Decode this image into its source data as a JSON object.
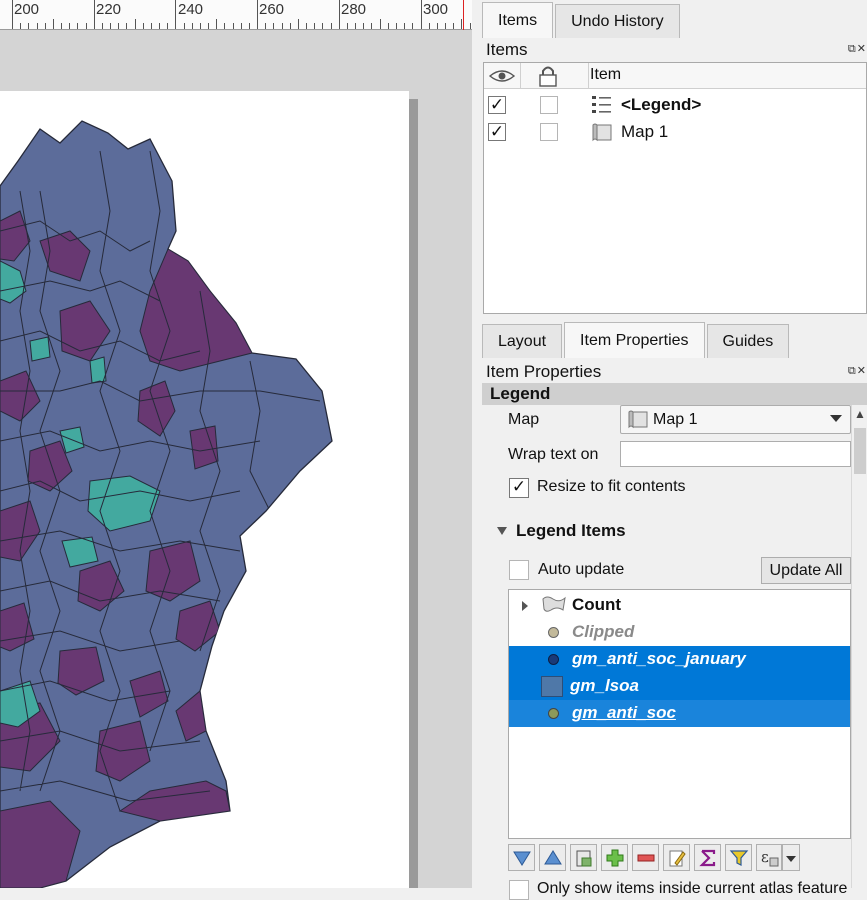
{
  "ruler": {
    "labels": [
      "200",
      "220",
      "240",
      "260",
      "280",
      "300"
    ]
  },
  "colors": {
    "region_blue": "#5c6c9a",
    "region_purple": "#683872",
    "region_teal": "#43a99f",
    "selection": "#0078d7"
  },
  "items_panel": {
    "tabs": [
      "Items",
      "Undo History"
    ],
    "title": "Items",
    "column_header": "Item",
    "icons": [
      "eye-icon",
      "lock-icon"
    ],
    "rows": [
      {
        "label": "<Legend>",
        "visible": true,
        "locked": false,
        "icon": "legend-icon"
      },
      {
        "label": "Map 1",
        "visible": true,
        "locked": false,
        "icon": "map-icon"
      }
    ]
  },
  "props_panel": {
    "tabs": [
      "Layout",
      "Item Properties",
      "Guides"
    ],
    "title": "Item Properties",
    "group": "Legend",
    "map_label": "Map",
    "map_value": "Map 1",
    "wrap_label": "Wrap text on",
    "wrap_value": "",
    "resize_label": "Resize to fit contents",
    "resize_checked": true,
    "legend_items_title": "Legend Items",
    "auto_update_label": "Auto update",
    "update_all_label": "Update All",
    "tree": [
      {
        "label": "Count",
        "style": "group"
      },
      {
        "label": "Clipped",
        "style": "grey"
      },
      {
        "label": "gm_anti_soc_january",
        "style": "selected"
      },
      {
        "label": "gm_lsoa",
        "style": "selected"
      },
      {
        "label": "gm_anti_soc",
        "style": "selected-underline"
      }
    ],
    "toolbar_icons": [
      "move-down-icon",
      "move-up-icon",
      "add-group-icon",
      "add-item-icon",
      "remove-item-icon",
      "edit-item-icon",
      "sum-icon",
      "filter-icon",
      "expression-icon",
      "dropdown-arrow-icon"
    ],
    "cut_off_text": "Only show items inside current atlas feature"
  }
}
